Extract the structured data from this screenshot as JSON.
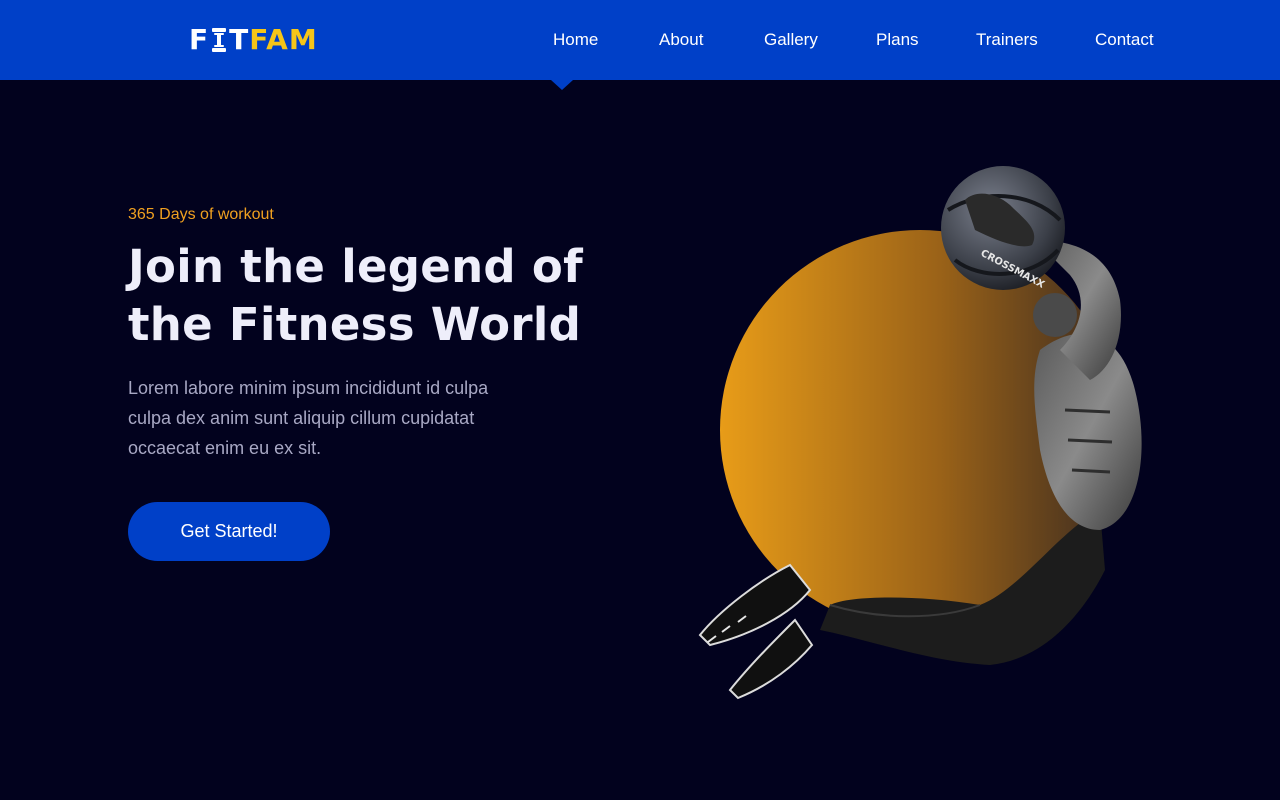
{
  "brand": {
    "logo_part1": "F",
    "logo_part2": "T",
    "logo_part3": "FAM",
    "colors": {
      "primary": "#0040c8",
      "accent": "#f5c518",
      "background": "#02021e",
      "eyebrow": "#f0a020"
    }
  },
  "nav": {
    "active": "Home",
    "items": [
      {
        "id": "home",
        "label": "Home"
      },
      {
        "id": "about",
        "label": "About"
      },
      {
        "id": "gallery",
        "label": "Gallery"
      },
      {
        "id": "plans",
        "label": "Plans"
      },
      {
        "id": "trainers",
        "label": "Trainers"
      },
      {
        "id": "contact",
        "label": "Contact"
      }
    ]
  },
  "hero": {
    "eyebrow": "365 Days of workout",
    "title_line1": "Join the legend of",
    "title_line2": "the Fitness World",
    "body_line1": "Lorem labore minim ipsum incididunt id culpa",
    "body_line2": "culpa dex anim sunt aliquip cillum cupidatat",
    "body_line3": "occaecat enim eu ex sit.",
    "cta_label": "Get Started!",
    "ball_text": "CROSSMAXX"
  }
}
